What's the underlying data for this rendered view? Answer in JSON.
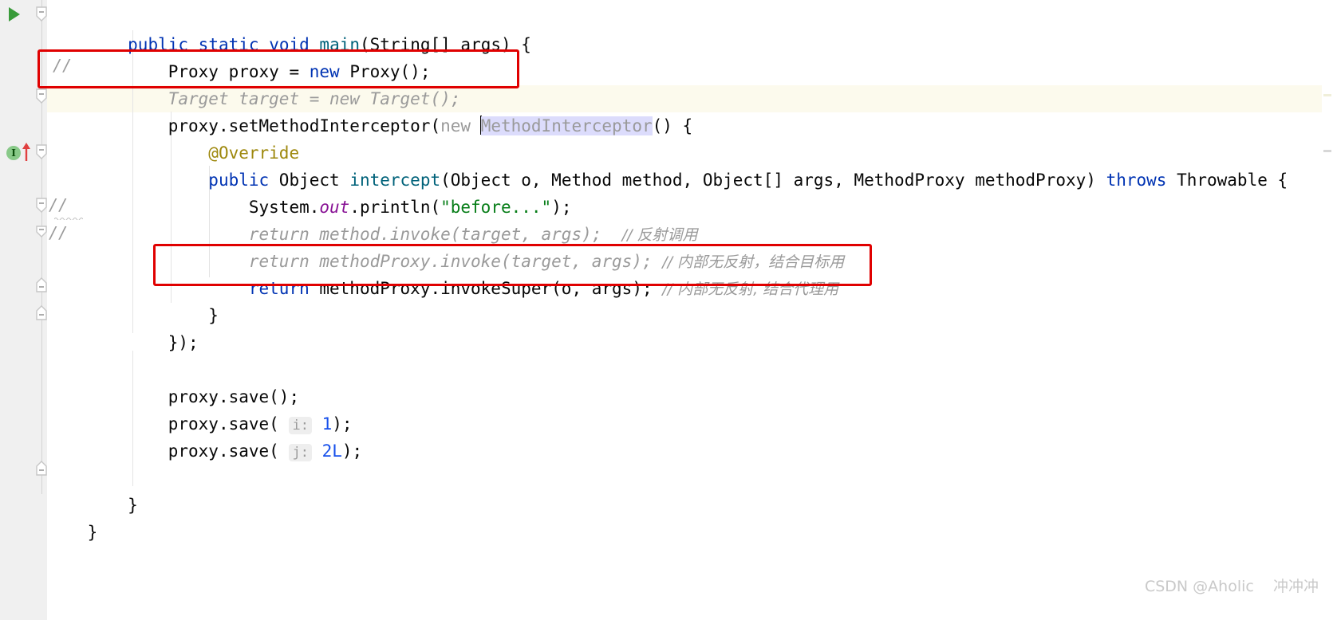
{
  "editor": {
    "language": "java",
    "background": "#ffffff",
    "gutter_background": "#f0f0f0",
    "current_line_highlight": "#fcfaed",
    "selection_color": "#dcdcfc",
    "annotation_box_color": "#e00000"
  },
  "code_lines": [
    {
      "n": 1,
      "indent": "    ",
      "text": "public static void main(String[] args) {",
      "tokens": [
        {
          "t": "    ",
          "c": "plain"
        },
        {
          "t": "public",
          "c": "kw"
        },
        {
          "t": " ",
          "c": "plain"
        },
        {
          "t": "static",
          "c": "kw"
        },
        {
          "t": " ",
          "c": "plain"
        },
        {
          "t": "void",
          "c": "kw"
        },
        {
          "t": " ",
          "c": "plain"
        },
        {
          "t": "main",
          "c": "method"
        },
        {
          "t": "(String[] args) {",
          "c": "plain"
        }
      ]
    },
    {
      "n": 2,
      "text": "        Proxy proxy = new Proxy();",
      "tokens": [
        {
          "t": "        Proxy proxy = ",
          "c": "plain"
        },
        {
          "t": "new",
          "c": "kw"
        },
        {
          "t": " Proxy();",
          "c": "plain"
        }
      ]
    },
    {
      "n": 3,
      "text": "//        Target target = new Target();",
      "comment": true,
      "gutter_comment": "//",
      "tokens": [
        {
          "t": "        Target target = new Target();",
          "c": "cmt-gray"
        }
      ]
    },
    {
      "n": 4,
      "text": "        proxy.setMethodInterceptor(new MethodInterceptor() {",
      "highlighted": true,
      "tokens": [
        {
          "t": "        proxy.setMethodInterceptor(",
          "c": "plain"
        },
        {
          "t": "new",
          "c": "dim"
        },
        {
          "t": " ",
          "c": "plain"
        },
        {
          "t": "MethodInterceptor",
          "c": "dim",
          "selected": true
        },
        {
          "t": "() {",
          "c": "plain"
        }
      ]
    },
    {
      "n": 5,
      "text": "            @Override",
      "tokens": [
        {
          "t": "            @Override",
          "c": "anno"
        }
      ]
    },
    {
      "n": 6,
      "text": "            public Object intercept(Object o, Method method, Object[] args, MethodProxy methodProxy) throws Throwable {",
      "tokens": [
        {
          "t": "            ",
          "c": "plain"
        },
        {
          "t": "public",
          "c": "kw"
        },
        {
          "t": " Object ",
          "c": "plain"
        },
        {
          "t": "intercept",
          "c": "method"
        },
        {
          "t": "(Object o, Method method, Object[] args, MethodProxy methodProxy) ",
          "c": "plain"
        },
        {
          "t": "throws",
          "c": "kw"
        },
        {
          "t": " Throwable {",
          "c": "plain"
        }
      ]
    },
    {
      "n": 7,
      "text": "                System.out.println(\"before...\");",
      "tokens": [
        {
          "t": "                System.",
          "c": "plain"
        },
        {
          "t": "out",
          "c": "field"
        },
        {
          "t": ".println(",
          "c": "plain"
        },
        {
          "t": "\"before...\"",
          "c": "str"
        },
        {
          "t": ");",
          "c": "plain"
        }
      ]
    },
    {
      "n": 8,
      "text": "//                return method.invoke(target, args);  // 反射调用",
      "comment": true,
      "gutter_comment": "//",
      "tokens": [
        {
          "t": "                return method.invoke(target, args);  ",
          "c": "cmt-gray"
        },
        {
          "t": "// 反射调用",
          "c": "cmt-cn"
        }
      ]
    },
    {
      "n": 9,
      "text": "//                return methodProxy.invoke(target, args); // 内部无反射，结合目标用",
      "comment": true,
      "gutter_comment": "//",
      "tokens": [
        {
          "t": "                return methodProxy.invoke(target, args); ",
          "c": "cmt-gray"
        },
        {
          "t": "// 内部无反射，结合目标用",
          "c": "cmt-cn"
        }
      ]
    },
    {
      "n": 10,
      "text": "                return methodProxy.invokeSuper(o, args); // 内部无反射, 结合代理用",
      "tokens": [
        {
          "t": "                ",
          "c": "plain"
        },
        {
          "t": "return",
          "c": "kw"
        },
        {
          "t": " methodProxy.invokeSuper(o, args); ",
          "c": "plain"
        },
        {
          "t": "// 内部无反射, 结合代理用",
          "c": "cmt-cn"
        }
      ]
    },
    {
      "n": 11,
      "text": "            }",
      "tokens": [
        {
          "t": "            }",
          "c": "plain"
        }
      ]
    },
    {
      "n": 12,
      "text": "        });",
      "tokens": [
        {
          "t": "        });",
          "c": "plain"
        }
      ]
    },
    {
      "n": 13,
      "text": "",
      "tokens": []
    },
    {
      "n": 14,
      "text": "        proxy.save();",
      "tokens": [
        {
          "t": "        proxy.save();",
          "c": "plain"
        }
      ]
    },
    {
      "n": 15,
      "text": "        proxy.save( i: 1);",
      "param_hint": "i:",
      "tokens": [
        {
          "t": "        proxy.save( ",
          "c": "plain"
        },
        {
          "t": "i:",
          "c": "hint"
        },
        {
          "t": " ",
          "c": "plain"
        },
        {
          "t": "1",
          "c": "num"
        },
        {
          "t": ");",
          "c": "plain"
        }
      ]
    },
    {
      "n": 16,
      "text": "        proxy.save( j: 2L);",
      "param_hint": "j:",
      "tokens": [
        {
          "t": "        proxy.save( ",
          "c": "plain"
        },
        {
          "t": "j:",
          "c": "hint"
        },
        {
          "t": " ",
          "c": "plain"
        },
        {
          "t": "2L",
          "c": "num"
        },
        {
          "t": ");",
          "c": "plain"
        }
      ]
    },
    {
      "n": 17,
      "text": "",
      "tokens": []
    },
    {
      "n": 18,
      "text": "    }",
      "tokens": [
        {
          "t": "    }",
          "c": "plain"
        }
      ]
    },
    {
      "n": 19,
      "text": "}",
      "tokens": [
        {
          "t": "}",
          "c": "plain"
        }
      ]
    }
  ],
  "gutter": {
    "run_icon": "run-triangle-icon",
    "implementation_icon": "implementing-method-icon",
    "implementation_letter": "I",
    "fold_markers": [
      "collapse-icon",
      "collapse-icon",
      "collapse-icon",
      "collapse-icon",
      "collapse-icon",
      "collapse-icon",
      "collapse-icon"
    ],
    "commented_markers": [
      "//",
      "//",
      "//"
    ]
  },
  "annotations": {
    "box1_label": "commented-target-line-highlight",
    "box2_label": "invokeSuper-line-highlight"
  },
  "watermark": {
    "text": "CSDN @Aholic    冲冲冲"
  }
}
